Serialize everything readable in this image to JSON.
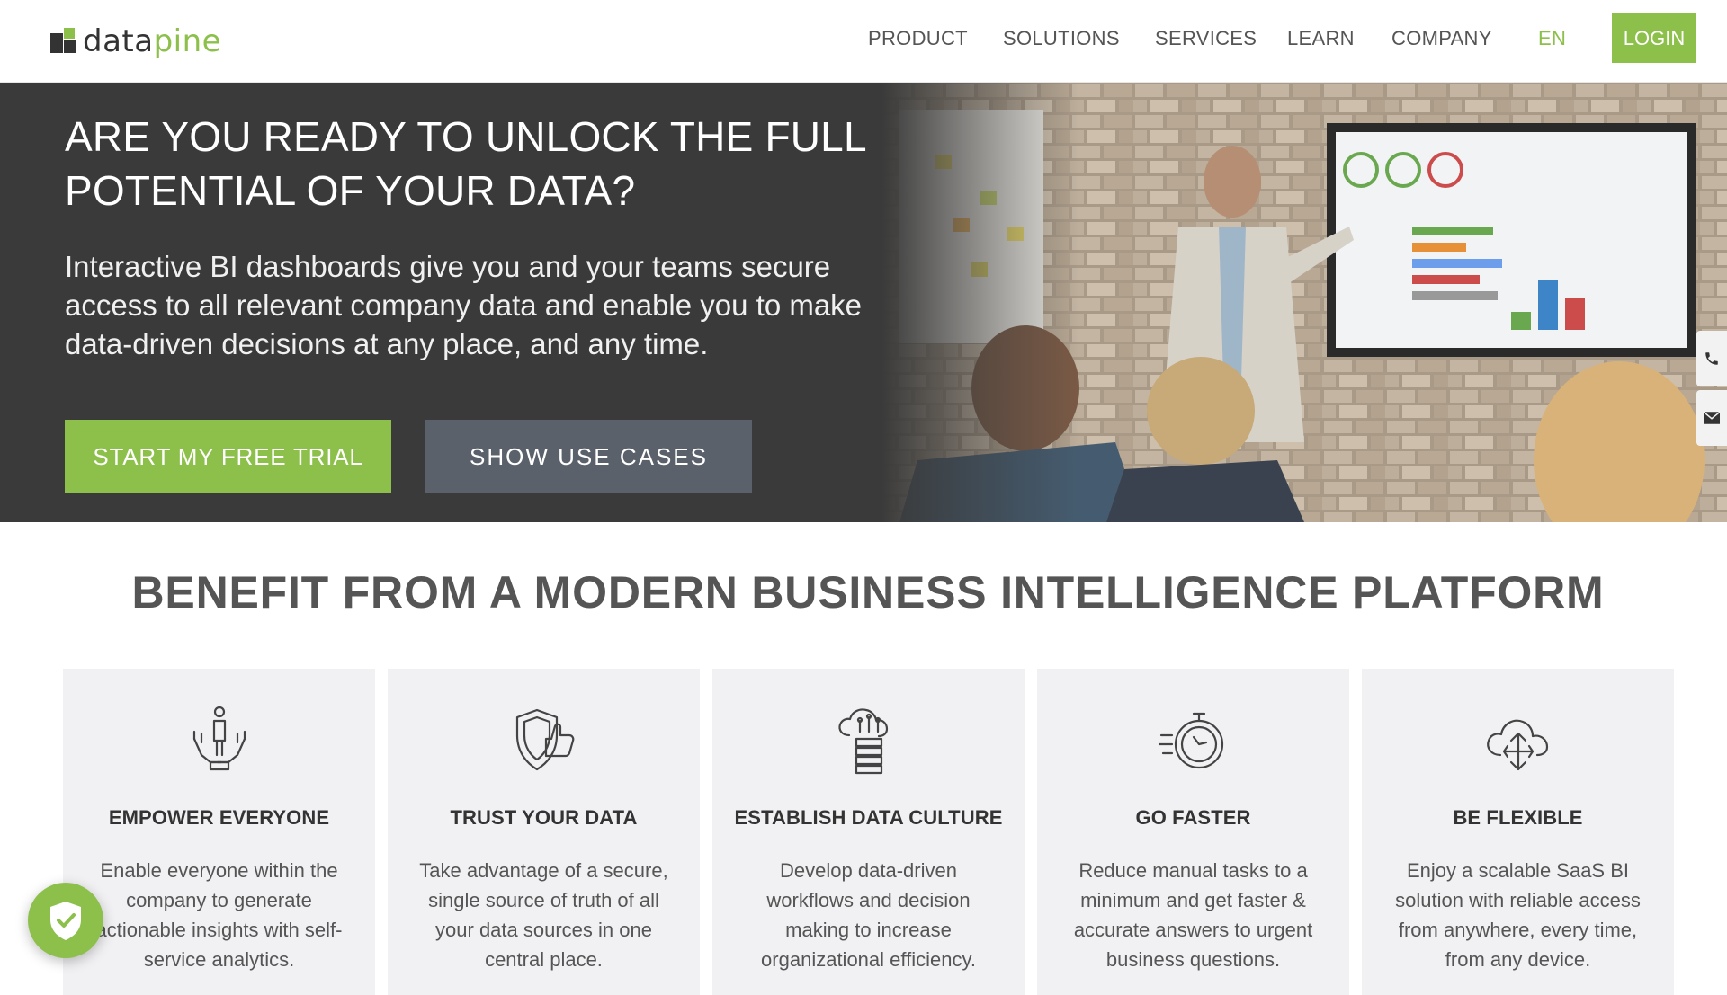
{
  "header": {
    "logo": {
      "part1": "data",
      "part2": "pine"
    },
    "nav": [
      "PRODUCT",
      "SOLUTIONS",
      "SERVICES",
      "LEARN",
      "COMPANY"
    ],
    "language": "EN",
    "login": "LOGIN"
  },
  "hero": {
    "title": "ARE YOU READY TO UNLOCK THE FULL POTENTIAL OF YOUR DATA?",
    "subtitle": "Interactive BI dashboards give you and your teams secure access to all relevant company data and enable you to make data-driven decisions at any place, and any time.",
    "primary_button": "START MY FREE TRIAL",
    "secondary_button": "SHOW USE CASES"
  },
  "benefits": {
    "title": "BENEFIT FROM A MODERN BUSINESS INTELLIGENCE PLATFORM",
    "cards": [
      {
        "title": "EMPOWER EVERYONE",
        "text": "Enable everyone within the company to generate actionable insights with self-service analytics.",
        "icon": "hands-person-icon"
      },
      {
        "title": "TRUST YOUR DATA",
        "text": "Take advantage of a secure, single source of truth of all your data sources in one central place.",
        "icon": "shield-thumbs-up-icon"
      },
      {
        "title": "ESTABLISH DATA CULTURE",
        "text": "Develop data-driven workflows and decision making to increase organizational efficiency.",
        "icon": "cloud-database-icon"
      },
      {
        "title": "GO FASTER",
        "text": "Reduce manual tasks to a minimum and get faster & accurate answers to urgent business questions.",
        "icon": "stopwatch-icon"
      },
      {
        "title": "BE FLEXIBLE",
        "text": "Enjoy a scalable SaaS BI solution with reliable access from anywhere, every time, from any device.",
        "icon": "cloud-arrows-icon"
      }
    ]
  },
  "colors": {
    "accent": "#8cc04b",
    "hero_bg": "#3a3a3a",
    "secondary_button": "#5b616b",
    "card_bg": "#f1f1f3"
  }
}
